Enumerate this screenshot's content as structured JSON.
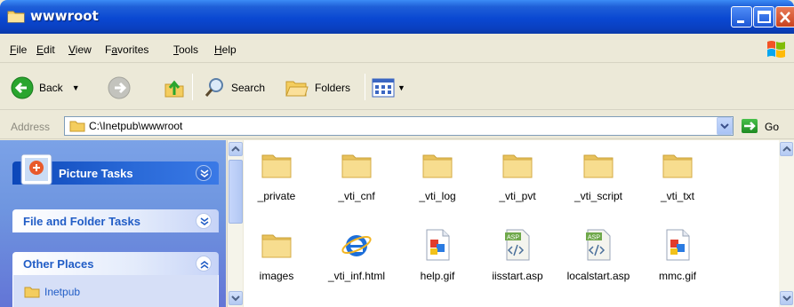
{
  "window": {
    "title": "wwwroot"
  },
  "menu": [
    "File",
    "Edit",
    "View",
    "Favorites",
    "Tools",
    "Help"
  ],
  "menu_underline": [
    "F",
    "E",
    "V",
    "a",
    "T",
    "H"
  ],
  "toolbar": {
    "back": "Back",
    "search": "Search",
    "folders": "Folders"
  },
  "address": {
    "label": "Address",
    "path": "C:\\Inetpub\\wwwroot",
    "go": "Go"
  },
  "tasks": {
    "picture": "Picture Tasks",
    "file_folder": "File and Folder Tasks",
    "other": "Other Places",
    "other_items": [
      "Inetpub"
    ]
  },
  "files": [
    {
      "name": "_private",
      "icon": "folder-icon"
    },
    {
      "name": "_vti_cnf",
      "icon": "folder-icon"
    },
    {
      "name": "_vti_log",
      "icon": "folder-icon"
    },
    {
      "name": "_vti_pvt",
      "icon": "folder-icon"
    },
    {
      "name": "_vti_script",
      "icon": "folder-icon"
    },
    {
      "name": "_vti_txt",
      "icon": "folder-icon"
    },
    {
      "name": "images",
      "icon": "folder-icon"
    },
    {
      "name": "_vti_inf.html",
      "icon": "ie-html-icon"
    },
    {
      "name": "help.gif",
      "icon": "gif-icon"
    },
    {
      "name": "iisstart.asp",
      "icon": "asp-icon"
    },
    {
      "name": "localstart.asp",
      "icon": "asp-icon"
    },
    {
      "name": "mmc.gif",
      "icon": "gif-icon"
    }
  ],
  "colors": {
    "titlebar": "#0a48d2",
    "taskpane": "#6f96e0",
    "panel_title": "#215dc6",
    "folder": "#f5d27a"
  }
}
